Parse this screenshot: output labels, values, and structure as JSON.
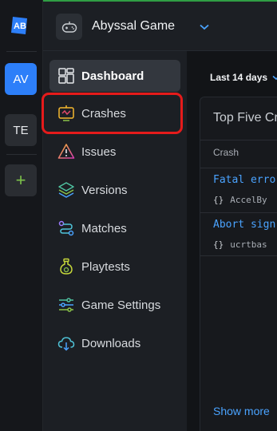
{
  "workspace_rail": {
    "logo_label": "AB",
    "workspaces": [
      {
        "label": "AV"
      },
      {
        "label": "TE"
      }
    ],
    "add_label": "+"
  },
  "project": {
    "name": "Abyssal Game"
  },
  "nav": {
    "items": [
      {
        "label": "Dashboard",
        "icon": "dashboard-icon"
      },
      {
        "label": "Crashes",
        "icon": "crash-monitor-icon"
      },
      {
        "label": "Issues",
        "icon": "warning-triangle-icon"
      },
      {
        "label": "Versions",
        "icon": "layers-icon"
      },
      {
        "label": "Matches",
        "icon": "route-icon"
      },
      {
        "label": "Playtests",
        "icon": "potion-icon"
      },
      {
        "label": "Game Settings",
        "icon": "sliders-icon"
      },
      {
        "label": "Downloads",
        "icon": "cloud-download-icon"
      }
    ]
  },
  "main": {
    "date_range": "Last 14 days",
    "card": {
      "title": "Top Five Cra",
      "column_header": "Crash",
      "rows": [
        {
          "title": "Fatal erro",
          "brace": "{}",
          "module": "AccelBy"
        },
        {
          "title": "Abort sign",
          "brace": "{}",
          "module": "ucrtbas"
        }
      ],
      "show_more": "Show more"
    }
  },
  "colors": {
    "accent_blue": "#2d7ff9",
    "link_blue": "#4aa3ff",
    "highlight_red": "#e51b1b",
    "top_line_green": "#2f9e44"
  }
}
